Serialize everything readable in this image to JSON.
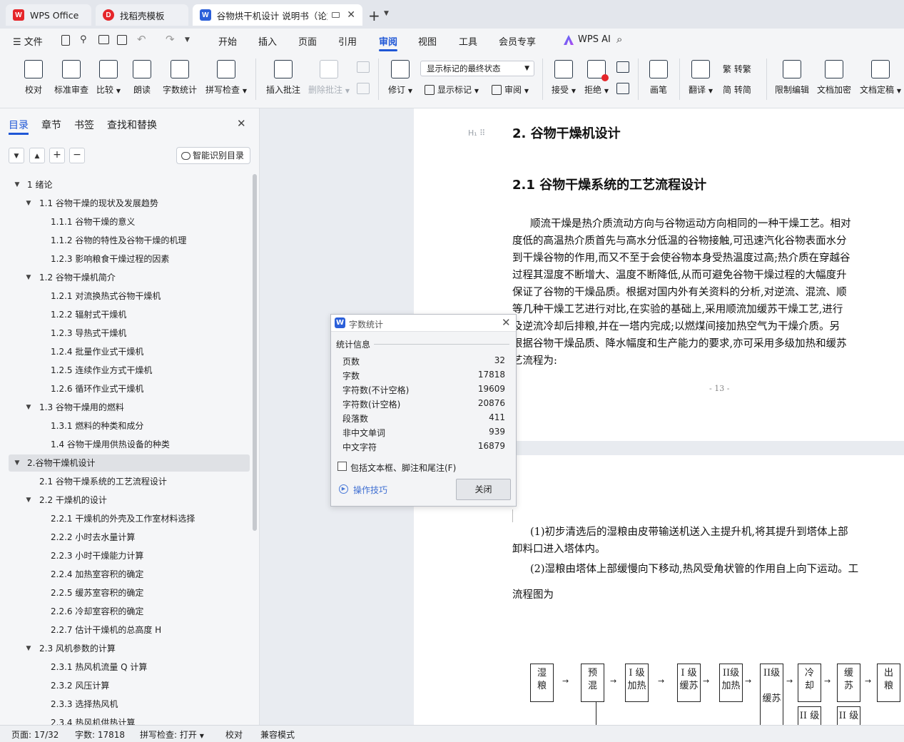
{
  "tabs": {
    "wps_office": "WPS Office",
    "template": "找稻壳模板",
    "doc": "谷物烘干机设计 说明书（论文",
    "add": "+"
  },
  "menu": {
    "file": "文件",
    "items": [
      "开始",
      "插入",
      "页面",
      "引用",
      "审阅",
      "视图",
      "工具",
      "会员专享"
    ],
    "active_index": 4,
    "wps_ai": "WPS AI"
  },
  "ribbon": {
    "proofread": "校对",
    "standard_review": "标准审查",
    "compare": "比较",
    "read_aloud": "朗读",
    "word_count": "字数统计",
    "spell_check": "拼写检查",
    "insert_comment": "插入批注",
    "delete_comment": "删除批注",
    "revise": "修订",
    "markup_display": "显示标记的最终状态",
    "show_markup": "显示标记",
    "review": "审阅",
    "accept": "接受",
    "reject": "拒绝",
    "pen": "画笔",
    "translate": "翻译",
    "to_traditional": "转繁",
    "to_simplified": "转简",
    "restrict_edit": "限制编辑",
    "encrypt": "文档加密",
    "finalize": "文档定稿"
  },
  "nav": {
    "tabs": [
      "目录",
      "章节",
      "书签",
      "查找和替换"
    ],
    "smart_toc": "智能识别目录",
    "toc": [
      {
        "t": "1 绪论",
        "l": 0,
        "a": true
      },
      {
        "t": "1.1 谷物干燥的现状及发展趋势",
        "l": 1,
        "a": true
      },
      {
        "t": "1.1.1 谷物干燥的意义",
        "l": 2
      },
      {
        "t": "1.1.2 谷物的特性及谷物干燥的机理",
        "l": 2
      },
      {
        "t": "1.2.3 影响粮食干燥过程的因素",
        "l": 2
      },
      {
        "t": "1.2  谷物干燥机简介",
        "l": 1,
        "a": true
      },
      {
        "t": "1.2.1 对流换热式谷物干燥机",
        "l": 2
      },
      {
        "t": "1.2.2 辐射式干燥机",
        "l": 2
      },
      {
        "t": "1.2.3 导热式干燥机",
        "l": 2
      },
      {
        "t": "1.2.4 批量作业式干燥机",
        "l": 2
      },
      {
        "t": "1.2.5 连续作业方式干燥机",
        "l": 2
      },
      {
        "t": "1.2.6  循环作业式干燥机",
        "l": 2
      },
      {
        "t": "1.3  谷物干燥用的燃料",
        "l": 1,
        "a": true
      },
      {
        "t": "1.3.1 燃料的种类和成分",
        "l": 2
      },
      {
        "t": "1.4  谷物干燥用供热设备的种类",
        "l": 2
      },
      {
        "t": "2.谷物干燥机设计",
        "l": 0,
        "a": true,
        "sel": true
      },
      {
        "t": "2.1 谷物干燥系统的工艺流程设计",
        "l": 1
      },
      {
        "t": "2.2 干燥机的设计",
        "l": 1,
        "a": true
      },
      {
        "t": "2.2.1  干燥机的外壳及工作室材料选择",
        "l": 2
      },
      {
        "t": "2.2.2  小时去水量计算",
        "l": 2
      },
      {
        "t": "2.2.3  小时干燥能力计算",
        "l": 2
      },
      {
        "t": "2.2.4  加热室容积的确定",
        "l": 2
      },
      {
        "t": "2.2.5  缓苏室容积的确定",
        "l": 2
      },
      {
        "t": "2.2.6  冷却室容积的确定",
        "l": 2
      },
      {
        "t": "2.2.7 估计干燥机的总高度 H",
        "l": 2
      },
      {
        "t": "2.3 风机参数的计算",
        "l": 1,
        "a": true
      },
      {
        "t": "2.3.1 热风机流量 Q 计算",
        "l": 2
      },
      {
        "t": "2.3.2  风压计算",
        "l": 2
      },
      {
        "t": "2.3.3   选择热风机",
        "l": 2
      },
      {
        "t": "2.3.4 热风机供热计算",
        "l": 2
      }
    ]
  },
  "doc": {
    "h1": "2. 谷物干燥机设计",
    "h2": "2.1 谷物干燥系统的工艺流程设计",
    "para1": [
      "顺流干燥是热介质流动方向与谷物运动方向相同的一种干燥工艺。相对",
      "度低的高温热介质首先与高水分低温的谷物接触,可迅速汽化谷物表面水分",
      "到干燥谷物的作用,而又不至于会使谷物本身受热温度过高;热介质在穿越谷",
      "过程其湿度不断增大、温度不断降低,从而可避免谷物干燥过程的大幅度升",
      "保证了谷物的干燥品质。根据对国内外有关资料的分析,对逆流、混流、顺",
      "等几种干燥工艺进行对比,在实验的基础上,采用顺流加缓苏干燥工艺,进行",
      "及逆流冷却后排粮,并在一塔内完成;以燃煤间接加热空气为干燥介质。另",
      "根据谷物干燥品质、降水幅度和生产能力的要求,亦可采用多级加热和缓苏",
      "艺流程为:"
    ],
    "page_num": "- 13 -",
    "para2": [
      "(1)初步清选后的湿粮由皮带输送机送入主提升机,将其提升到塔体上部",
      "卸料口进入塔体内。",
      "(2)湿粮由塔体上部缓慢向下移动,热风受角状管的作用自上向下运动。工"
    ],
    "flow_label": "流程图为",
    "flow": [
      [
        "湿",
        "粮"
      ],
      [
        "预",
        "混"
      ],
      [
        "I 级",
        "加热"
      ],
      [
        "I 级",
        "缓苏"
      ],
      [
        "II级",
        "加热"
      ],
      [
        "II级",
        "",
        "缓苏"
      ],
      [
        "冷",
        "却"
      ],
      [
        "缓",
        "苏"
      ],
      [
        "出",
        "粮"
      ]
    ],
    "flow_sub": [
      "II 级",
      "II 级"
    ]
  },
  "dialog": {
    "title": "字数统计",
    "section": "统计信息",
    "rows": [
      [
        "页数",
        "32"
      ],
      [
        "字数",
        "17818"
      ],
      [
        "字符数(不计空格)",
        "19609"
      ],
      [
        "字符数(计空格)",
        "20876"
      ],
      [
        "段落数",
        "411"
      ],
      [
        "非中文单词",
        "939"
      ],
      [
        "中文字符",
        "16879"
      ]
    ],
    "checkbox": "包括文本框、脚注和尾注(F)",
    "tips": "操作技巧",
    "close": "关闭"
  },
  "status": {
    "page": "页面: 17/32",
    "words": "字数: 17818",
    "spell": "拼写检查: 打开",
    "proof": "校对",
    "compat": "兼容模式"
  },
  "colors": {
    "accent": "#1f57d6",
    "wps_red": "#e5262a",
    "word_blue": "#2b5fd9"
  }
}
